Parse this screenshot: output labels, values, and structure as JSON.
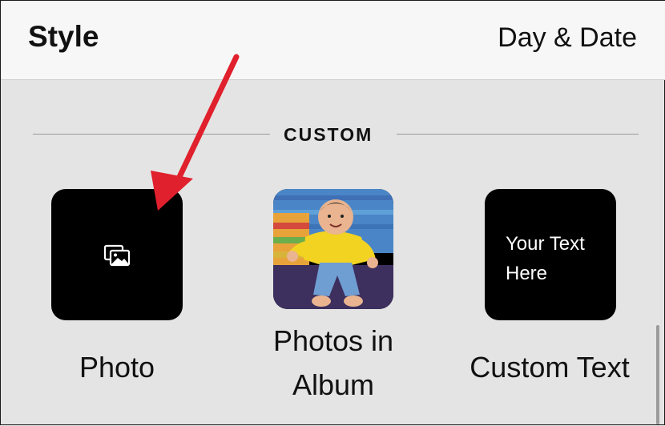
{
  "header": {
    "title": "Style",
    "tab_label": "Day & Date"
  },
  "section": {
    "label": "CUSTOM"
  },
  "options": [
    {
      "caption": "Photo",
      "icon": "photo-stack-icon"
    },
    {
      "caption": "Photos in\nAlbum",
      "thumbnail": "baby-photo-thumbnail"
    },
    {
      "caption": "Custom Text",
      "tile_text": "Your Text\nHere"
    }
  ],
  "annotation": {
    "color": "#e0202c"
  },
  "colors": {
    "background": "#e4e4e4",
    "topbar": "#f7f7f7",
    "tile": "#000000"
  }
}
